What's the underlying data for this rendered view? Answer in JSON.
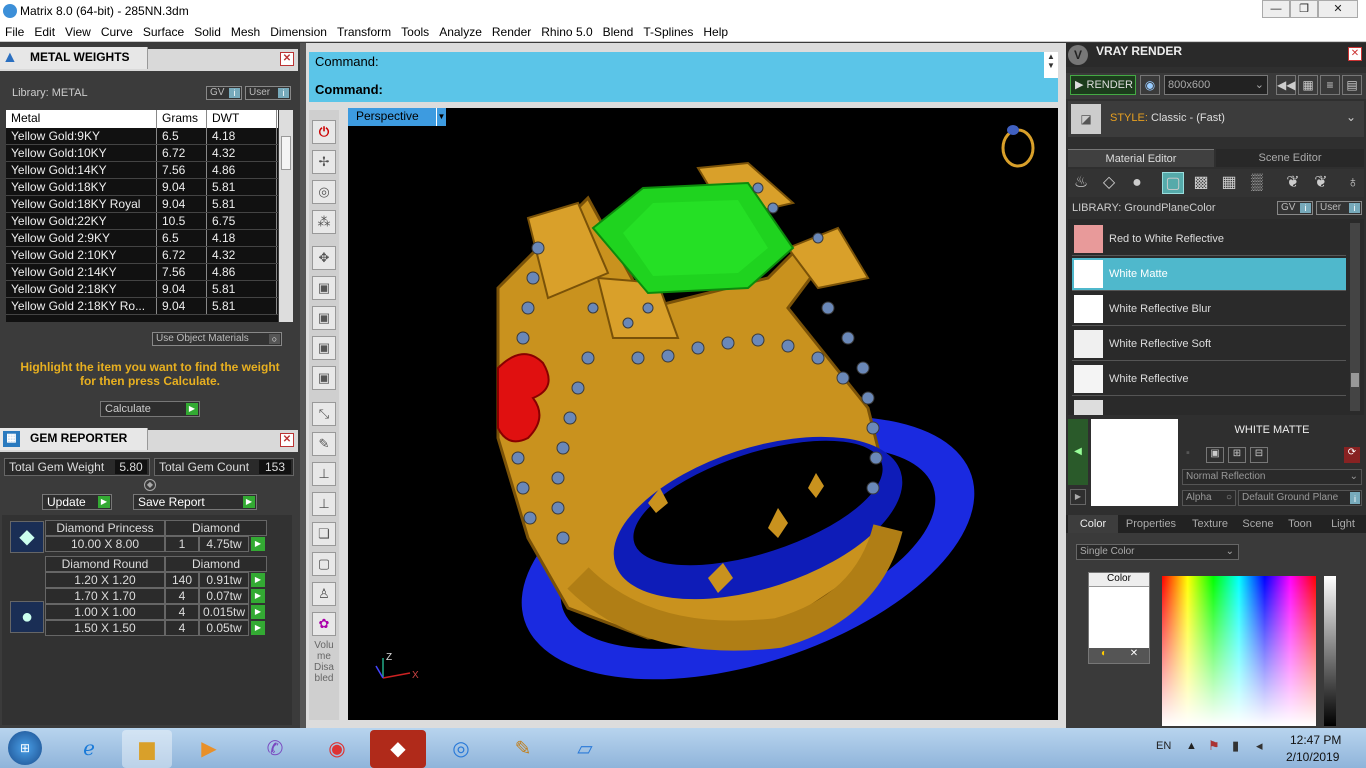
{
  "window": {
    "title": "Matrix 8.0 (64-bit) - 285NN.3dm",
    "min": "—",
    "max": "❐",
    "close": "✕"
  },
  "menu": [
    "File",
    "Edit",
    "View",
    "Curve",
    "Surface",
    "Solid",
    "Mesh",
    "Dimension",
    "Transform",
    "Tools",
    "Analyze",
    "Render",
    "Rhino 5.0",
    "Blend",
    "T-Splines",
    "Help"
  ],
  "metal_weights": {
    "title": "METAL WEIGHTS",
    "library_label": "Library: METAL",
    "gv": "GV",
    "user": "User",
    "toggle": "i",
    "columns": [
      "Metal",
      "Grams",
      "DWT"
    ],
    "rows": [
      [
        "Yellow Gold:9KY",
        "6.5",
        "4.18"
      ],
      [
        "Yellow Gold:10KY",
        "6.72",
        "4.32"
      ],
      [
        "Yellow Gold:14KY",
        "7.56",
        "4.86"
      ],
      [
        "Yellow Gold:18KY",
        "9.04",
        "5.81"
      ],
      [
        "Yellow Gold:18KY Royal",
        "9.04",
        "5.81"
      ],
      [
        "Yellow Gold:22KY",
        "10.5",
        "6.75"
      ],
      [
        "Yellow Gold 2:9KY",
        "6.5",
        "4.18"
      ],
      [
        "Yellow Gold 2:10KY",
        "6.72",
        "4.32"
      ],
      [
        "Yellow Gold 2:14KY",
        "7.56",
        "4.86"
      ],
      [
        "Yellow Gold 2:18KY",
        "9.04",
        "5.81"
      ],
      [
        "Yellow Gold 2:18KY Ro...",
        "9.04",
        "5.81"
      ]
    ],
    "use_object_materials": "Use Object Materials",
    "hint": "Highlight the item you want to find the weight for then press Calculate.",
    "calculate": "Calculate"
  },
  "gem_reporter": {
    "title": "GEM REPORTER",
    "total_weight_label": "Total Gem Weight",
    "total_weight": "5.80",
    "total_count_label": "Total Gem Count",
    "total_count": "153",
    "update": "Update",
    "save_report": "Save Report",
    "groups": [
      {
        "shape": "Diamond Princess",
        "type": "Diamond",
        "rows": [
          [
            "10.00 X 8.00",
            "1",
            "4.75tw"
          ]
        ]
      },
      {
        "shape": "Diamond Round",
        "type": "Diamond",
        "rows": [
          [
            "1.20 X 1.20",
            "140",
            "0.91tw"
          ],
          [
            "1.70 X 1.70",
            "4",
            "0.07tw"
          ],
          [
            "1.00 X 1.00",
            "4",
            "0.015tw"
          ],
          [
            "1.50 X 1.50",
            "4",
            "0.05tw"
          ]
        ]
      }
    ]
  },
  "command": {
    "line1": "Command:",
    "line2": "Command:"
  },
  "viewport": {
    "label": "Perspective",
    "axis_z": "Z",
    "axis_x": "X",
    "toolbar_note": "Volume Disabled"
  },
  "vray": {
    "title": "VRAY RENDER",
    "render": "RENDER",
    "resolution": "800x600",
    "style_label": "STYLE:",
    "style_value": "Classic - (Fast)",
    "tabs": [
      "Material Editor",
      "Scene Editor"
    ],
    "library": "LIBRARY: GroundPlaneColor",
    "gv": "GV",
    "user": "User",
    "materials": [
      {
        "name": "Red to White Reflective",
        "color": "#e89a9a"
      },
      {
        "name": "White Matte",
        "color": "#ffffff",
        "selected": true
      },
      {
        "name": "White Reflective Blur",
        "color": "#ffffff"
      },
      {
        "name": "White Reflective Soft",
        "color": "#f0f0f0"
      },
      {
        "name": "White Reflective",
        "color": "#f4f4f4"
      }
    ],
    "preview_title": "WHITE MATTE",
    "reflection": "Normal Reflection",
    "alpha": "Alpha",
    "ground": "Default Ground Plane",
    "prop_tabs": [
      "Color",
      "Properties",
      "Texture",
      "Scene",
      "Toon",
      "Light"
    ],
    "color_mode": "Single Color",
    "color_label": "Color"
  },
  "taskbar": {
    "lang": "EN",
    "time": "12:47 PM",
    "date": "2/10/2019"
  },
  "colors": {
    "accent": "#5bc5e8",
    "selected": "#4fb8cc",
    "gold": "#c9921e",
    "gem": "#1fd31f",
    "band": "#1020d8"
  }
}
